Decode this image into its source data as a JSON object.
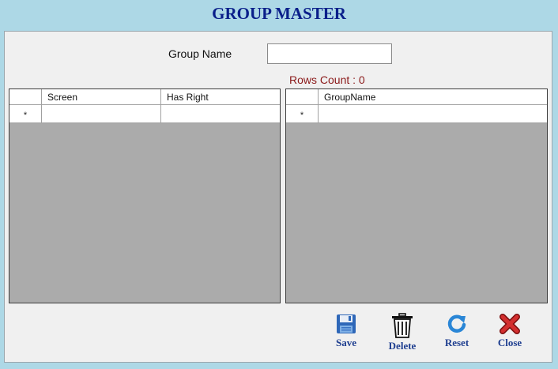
{
  "window": {
    "title": "GROUP MASTER"
  },
  "form": {
    "group_name_label": "Group Name",
    "group_name_value": "",
    "rows_count": "Rows Count : 0"
  },
  "grid_rights": {
    "columns": [
      "Screen",
      "Has Right"
    ],
    "new_row_marker": "*"
  },
  "grid_groups": {
    "columns": [
      "GroupName"
    ],
    "new_row_marker": "*"
  },
  "toolbar": {
    "save_label": "Save",
    "delete_label": "Delete",
    "reset_label": "Reset",
    "close_label": "Close"
  },
  "icons": {
    "save": "floppy-disk-icon",
    "delete": "trash-can-icon",
    "reset": "refresh-icon",
    "close": "red-x-icon"
  },
  "colors": {
    "background": "#add8e6",
    "title": "#0a1f8a",
    "rows_count": "#8b1a1a",
    "grid_empty": "#ababab",
    "button_caption": "#1d3d8f"
  }
}
